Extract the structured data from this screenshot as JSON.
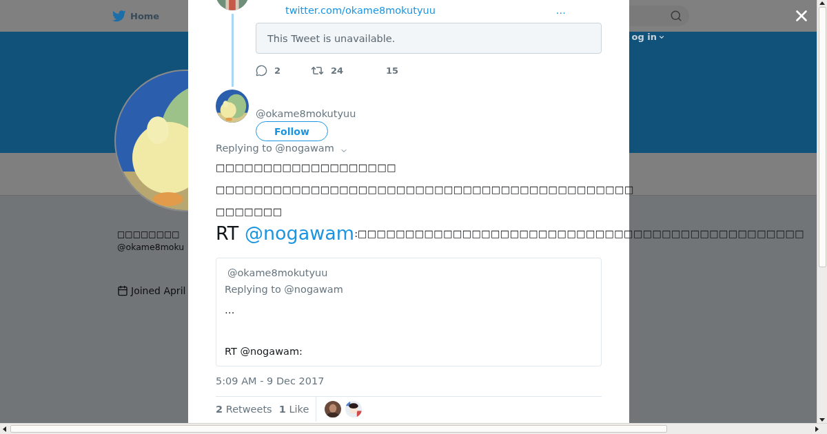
{
  "background_page": {
    "nav": {
      "home": "Home",
      "login": "og in"
    },
    "profile": {
      "name": "□□□□□□□□",
      "handle": "@okame8moku",
      "joined": "Joined April"
    }
  },
  "modal": {
    "previous_tweet": {
      "link": "twitter.com/okame8mokutyuu",
      "more": "…",
      "quoted_notice": "This Tweet is unavailable.",
      "replies": "2",
      "retweets": "24",
      "likes": "15"
    },
    "tweet": {
      "handle": "@okame8mokutyuu",
      "follow": "Follow",
      "replying_to": "Replying to @nogawam",
      "lines": [
        "□□□□□□□□□□□□□□□□□□□",
        "□□□□□□□□□□□□□□□□□□□□□□□□□□□□□□□□□□□□□□□□□□□□",
        "□□□□□□□"
      ],
      "rt_line": {
        "prefix": "RT ",
        "mention": "@nogawam",
        "rest": ":□□□□□□□□□□□□□□□□□□□□□□□□□□□□□□□□□□□□□□□□□□□□□□□"
      },
      "quote": {
        "handle": "@okame8mokutyuu",
        "replying_to": "Replying to @nogawam",
        "ellipsis": "…",
        "text": "RT @nogawam:"
      },
      "timestamp": "5:09 AM - 9 Dec 2017",
      "retweets": {
        "count": "2",
        "label": "Retweets"
      },
      "likes": {
        "count": "1",
        "label": "Like"
      }
    }
  }
}
